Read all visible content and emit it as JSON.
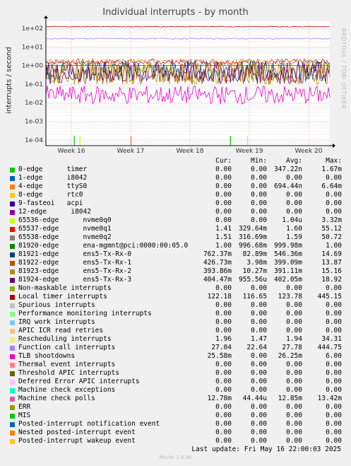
{
  "title": "Individual interrupts - by month",
  "side_label": "RRDTOOL / TOBI OETIKER",
  "chart_data": {
    "type": "line",
    "ylabel": "interrupts / second",
    "yscale": "log",
    "ylim": [
      5e-05,
      200
    ],
    "yticks": [
      "1e+02",
      "1e+01",
      "1e+00",
      "1e-01",
      "1e-02",
      "1e-03",
      "1e-04"
    ],
    "xticks": [
      "Week 16",
      "Week 17",
      "Week 18",
      "Week 19",
      "Week 20"
    ],
    "grid": true,
    "series": [
      {
        "name": "timer",
        "color": "#00cc00",
        "cur": "0.00",
        "min": "0.00",
        "avg": "347.22n",
        "max": "1.67m",
        "level": 0.0001,
        "spikes": [
          0.1,
          0.65
        ]
      },
      {
        "name": "i8042",
        "color": "#0066b3",
        "cur": "0.00",
        "min": "0.00",
        "avg": "0.00",
        "max": "0.00",
        "level": null
      },
      {
        "name": "ttyS0",
        "color": "#ff8000",
        "cur": "0.00",
        "min": "0.00",
        "avg": "694.44n",
        "max": "6.64m",
        "level": 0.0001,
        "spikes": [
          0.3
        ]
      },
      {
        "name": "rtc0",
        "color": "#ffcc00",
        "cur": "0.00",
        "min": "0.00",
        "avg": "0.00",
        "max": "0.00",
        "level": null
      },
      {
        "name": "acpi",
        "color": "#330099",
        "cur": "0.00",
        "min": "0.00",
        "avg": "0.00",
        "max": "0.00",
        "level": null
      },
      {
        "name": "i8042",
        "color": "#990099",
        "cur": "0.00",
        "min": "0.00",
        "avg": "0.00",
        "max": "0.00",
        "level": null
      },
      {
        "name": "nvme0q0",
        "color": "#ccff00",
        "cur": "0.00",
        "min": "0.00",
        "avg": "1.04u",
        "max": "3.32m",
        "level": 0.0001,
        "spikes": [
          0.12,
          0.71
        ]
      },
      {
        "name": "nvme0q1",
        "color": "#ff0000",
        "cur": "1.41",
        "min": "329.64m",
        "avg": "1.60",
        "max": "55.12",
        "level": 1.6,
        "noise": 0.15
      },
      {
        "name": "nvme0q2",
        "color": "#808080",
        "cur": "1.51",
        "min": "316.69m",
        "avg": "1.59",
        "max": "50.72",
        "level": 1.55,
        "noise": 0.15
      },
      {
        "name": "ena-mgmnt@pci:0000:00:05.0",
        "color": "#008f00",
        "cur": "1.00",
        "min": "996.68m",
        "avg": "999.98m",
        "max": "1.00",
        "level": 1.0,
        "noise": 0.01
      },
      {
        "name": "ens5-Tx-Rx-0",
        "color": "#00487d",
        "cur": "762.37m",
        "min": "82.89m",
        "avg": "546.36m",
        "max": "14.69",
        "level": 0.5,
        "noise": 0.6
      },
      {
        "name": "ens5-Tx-Rx-1",
        "color": "#b35a00",
        "cur": "426.73m",
        "min": "3.98m",
        "avg": "399.09m",
        "max": "13.87",
        "level": 0.4,
        "noise": 0.6
      },
      {
        "name": "ens5-Tx-Rx-2",
        "color": "#b38f00",
        "cur": "393.86m",
        "min": "10.27m",
        "avg": "391.11m",
        "max": "15.16",
        "level": 0.38,
        "noise": 0.6
      },
      {
        "name": "ens5-Tx-Rx-3",
        "color": "#6b006b",
        "cur": "404.47m",
        "min": "955.56u",
        "avg": "402.05m",
        "max": "18.92",
        "level": 0.4,
        "noise": 0.6
      },
      {
        "name": "Non-maskable interrupts",
        "color": "#8fb300",
        "cur": "0.00",
        "min": "0.00",
        "avg": "0.00",
        "max": "0.00",
        "level": null
      },
      {
        "name": "Local timer interrupts",
        "color": "#b30000",
        "cur": "122.18",
        "min": "116.65",
        "avg": "123.78",
        "max": "445.15",
        "level": 123,
        "noise": 0.02
      },
      {
        "name": "Spurious interrupts",
        "color": "#bebebe",
        "cur": "0.00",
        "min": "0.00",
        "avg": "0.00",
        "max": "0.00",
        "level": null
      },
      {
        "name": "Performance monitoring interrupts",
        "color": "#80ff80",
        "cur": "0.00",
        "min": "0.00",
        "avg": "0.00",
        "max": "0.00",
        "level": null
      },
      {
        "name": "IRQ work interrupts",
        "color": "#80c9ff",
        "cur": "0.00",
        "min": "0.00",
        "avg": "0.00",
        "max": "0.00",
        "level": null
      },
      {
        "name": "APIC ICR read retries",
        "color": "#ffc080",
        "cur": "0.00",
        "min": "0.00",
        "avg": "0.00",
        "max": "0.00",
        "level": null
      },
      {
        "name": "Rescheduling interrupts",
        "color": "#ffe680",
        "cur": "1.96",
        "min": "1.47",
        "avg": "1.94",
        "max": "34.31",
        "level": 1.94,
        "noise": 0.05
      },
      {
        "name": "Function call interrupts",
        "color": "#aa80ff",
        "cur": "27.04",
        "min": "22.64",
        "avg": "27.78",
        "max": "444.75",
        "level": 27.8,
        "noise": 0.03
      },
      {
        "name": "TLB shootdowns",
        "color": "#ee00cc",
        "cur": "25.58m",
        "min": "0.00",
        "avg": "26.25m",
        "max": "6.00",
        "level": 0.026,
        "noise": 0.5
      },
      {
        "name": "Thermal event interrupts",
        "color": "#ff8080",
        "cur": "0.00",
        "min": "0.00",
        "avg": "0.00",
        "max": "0.00",
        "level": null
      },
      {
        "name": "Threshold APIC interrupts",
        "color": "#666600",
        "cur": "0.00",
        "min": "0.00",
        "avg": "0.00",
        "max": "0.00",
        "level": null
      },
      {
        "name": "Deferred Error APIC interrupts",
        "color": "#ffbfff",
        "cur": "0.00",
        "min": "0.00",
        "avg": "0.00",
        "max": "0.00",
        "level": null
      },
      {
        "name": "Machine check exceptions",
        "color": "#00ffcc",
        "cur": "0.00",
        "min": "0.00",
        "avg": "0.00",
        "max": "0.00",
        "level": null
      },
      {
        "name": "Machine check polls",
        "color": "#cc6699",
        "cur": "12.78m",
        "min": "44.44u",
        "avg": "12.85m",
        "max": "13.42m",
        "level": null
      },
      {
        "name": "ERR",
        "color": "#999900",
        "cur": "0.00",
        "min": "0.00",
        "avg": "0.00",
        "max": "0.00",
        "level": null
      },
      {
        "name": "MIS",
        "color": "#00cc00",
        "cur": "0.00",
        "min": "0.00",
        "avg": "0.00",
        "max": "0.00",
        "level": null
      },
      {
        "name": "Posted-interrupt notification event",
        "color": "#0066b3",
        "cur": "0.00",
        "min": "0.00",
        "avg": "0.00",
        "max": "0.00",
        "level": null
      },
      {
        "name": "Nested posted-interrupt event",
        "color": "#ff8000",
        "cur": "0.00",
        "min": "0.00",
        "avg": "0.00",
        "max": "0.00",
        "level": null
      },
      {
        "name": "Posted-interrupt wakeup event",
        "color": "#ffcc00",
        "cur": "0.00",
        "min": "0.00",
        "avg": "0.00",
        "max": "0.00",
        "level": null
      }
    ]
  },
  "legend": {
    "headers": {
      "cur": "Cur:",
      "min": "Min:",
      "avg": "Avg:",
      "max": "Max:"
    },
    "labels": [
      "0-edge      timer",
      "1-edge      i8042",
      "4-edge      ttyS0",
      "8-edge      rtc0",
      "9-fasteoi   acpi",
      "12-edge      i8042",
      "65536-edge      nvme0q0",
      "65537-edge      nvme0q1",
      "65538-edge      nvme0q2",
      "81920-edge      ena-mgmnt@pci:0000:00:05.0",
      "81921-edge      ens5-Tx-Rx-0",
      "81922-edge      ens5-Tx-Rx-1",
      "81923-edge      ens5-Tx-Rx-2",
      "81924-edge      ens5-Tx-Rx-3",
      "Non-maskable interrupts",
      "Local timer interrupts",
      "Spurious interrupts",
      "Performance monitoring interrupts",
      "IRQ work interrupts",
      "APIC ICR read retries",
      "Rescheduling interrupts",
      "Function call interrupts",
      "TLB shootdowns",
      "Thermal event interrupts",
      "Threshold APIC interrupts",
      "Deferred Error APIC interrupts",
      "Machine check exceptions",
      "Machine check polls",
      "ERR",
      "MIS",
      "Posted-interrupt notification event",
      "Nested posted-interrupt event",
      "Posted-interrupt wakeup event"
    ]
  },
  "last_update": "Last update: Fri May 16 22:00:03 2025",
  "munin_version": "Munin 2.0.56"
}
